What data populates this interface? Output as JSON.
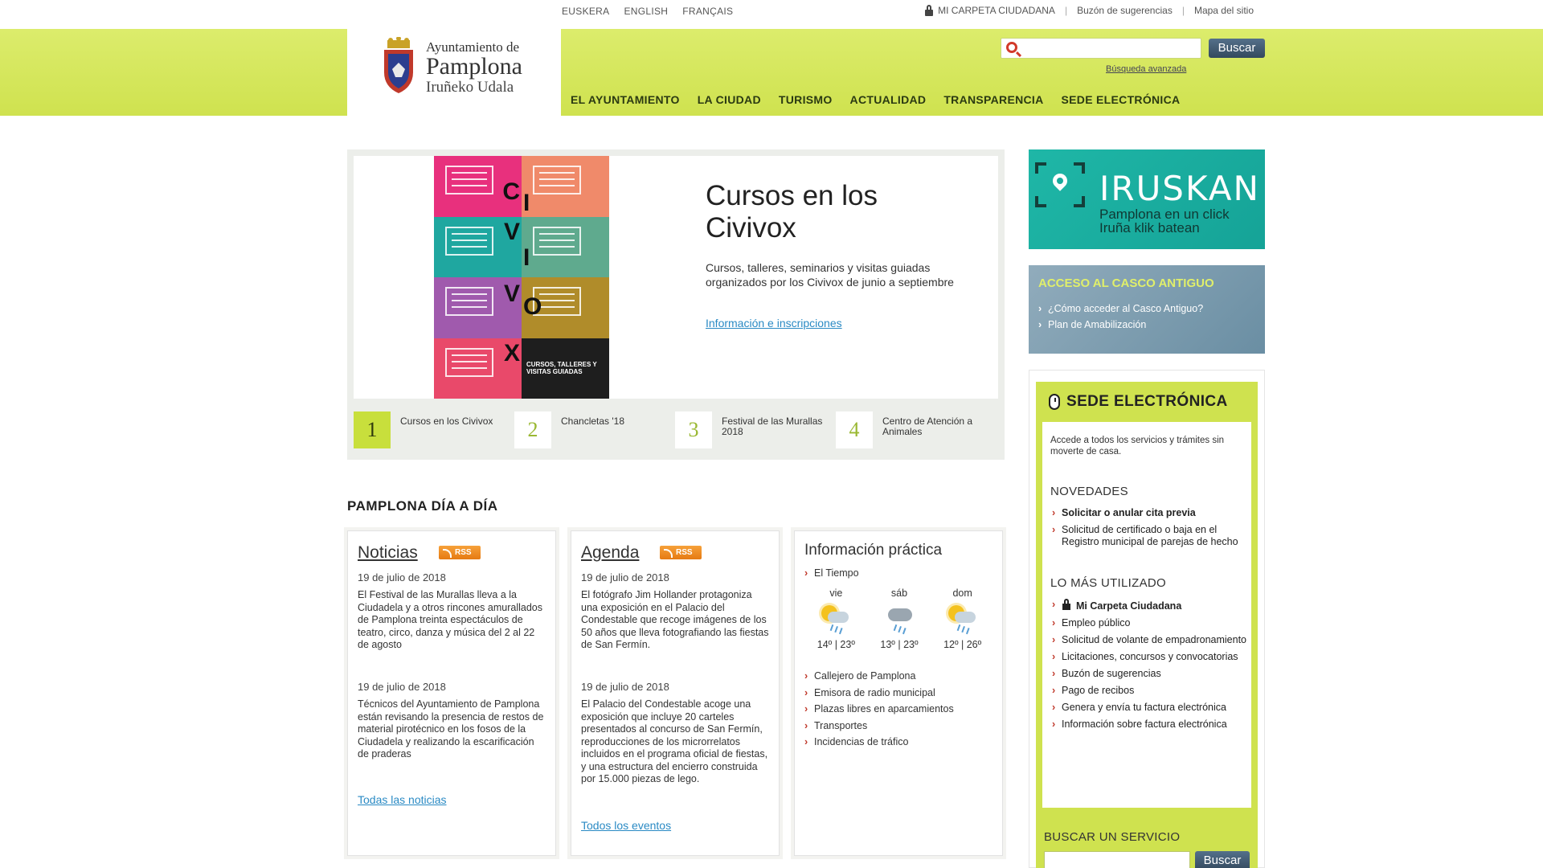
{
  "topbar": {
    "languages": [
      "EUSKERA",
      "ENGLISH",
      "FRANÇAIS"
    ],
    "carpeta": "MI CARPETA CIUDADANA",
    "buzon": "Buzón de sugerencias",
    "mapa": "Mapa del sitio"
  },
  "logo": {
    "line1": "Ayuntamiento de",
    "line2": "Pamplona",
    "line3": "Iruñeko Udala"
  },
  "search": {
    "button": "Buscar",
    "advanced": "Búsqueda avanzada"
  },
  "nav": [
    "EL AYUNTAMIENTO",
    "LA CIUDAD",
    "TURISMO",
    "ACTUALIDAD",
    "TRANSPARENCIA",
    "SEDE ELECTRÓNICA"
  ],
  "hero": {
    "title": "Cursos en los Civivox",
    "description": "Cursos, talleres, seminarios y visitas guiadas organizados por los Civivox de junio a septiembre",
    "link": "Información e inscripciones",
    "poster_letters": [
      "C",
      "I",
      "V",
      "I",
      "V",
      "O",
      "X"
    ],
    "poster_caption": "CURSOS, TALLERES Y VISITAS GUIADAS"
  },
  "slider_tabs": [
    {
      "num": "1",
      "label": "Cursos en los Civivox"
    },
    {
      "num": "2",
      "label": "Chancletas '18"
    },
    {
      "num": "3",
      "label": "Festival de las Murallas 2018"
    },
    {
      "num": "4",
      "label": "Centro de Atención a Animales"
    }
  ],
  "section_title": "PAMPLONA DÍA A DÍA",
  "noticias": {
    "title": "Noticias",
    "rss": "RSS",
    "items": [
      {
        "date": "19 de julio de 2018",
        "text": "El Festival de las Murallas lleva a la Ciudadela y a otros rincones amurallados de Pamplona treinta espectáculos de teatro, circo, danza y música del 2 al 22 de agosto"
      },
      {
        "date": "19 de julio de 2018",
        "text": "Técnicos del Ayuntamiento de Pamplona están revisando la presencia de restos de material pirotécnico en los fosos de la Ciudadela y realizando la escarificación de praderas"
      }
    ],
    "link": "Todas las noticias"
  },
  "agenda": {
    "title": "Agenda",
    "rss": "RSS",
    "items": [
      {
        "date": "19 de julio de 2018",
        "text": "El fotógrafo Jim Hollander protagoniza una exposición en el Palacio del Condestable que recoge imágenes de los 50 años que lleva fotografiando las fiestas de San Fermín."
      },
      {
        "date": "19 de julio de 2018",
        "text": "El Palacio del Condestable acoge una exposición que incluye 20 carteles presentados al concurso de San Fermín, reproducciones de los microrrelatos incluidos en el programa oficial de fiestas, y una estructura del encierro construida por 15.000 piezas de lego."
      }
    ],
    "link": "Todos los eventos"
  },
  "practica": {
    "title": "Información práctica",
    "tiempo": "El Tiempo",
    "weather": [
      {
        "day": "vie",
        "temp": "14º | 23º",
        "icon": "sun-rain-icon"
      },
      {
        "day": "sáb",
        "temp": "13º | 23º",
        "icon": "cloud-rain-icon"
      },
      {
        "day": "dom",
        "temp": "12º | 26º",
        "icon": "sun-rain-icon"
      }
    ],
    "links": [
      "Callejero de Pamplona",
      "Emisora de radio municipal",
      "Plazas libres en aparcamientos",
      "Transportes",
      "Incidencias de tráfico"
    ]
  },
  "iruskan": {
    "title": "IRUSKAN",
    "line1": "Pamplona en un click",
    "line2": "Iruña klik batean"
  },
  "casco": {
    "title": "ACCESO AL CASCO ANTIGUO",
    "links": [
      "¿Cómo acceder al Casco Antiguo?",
      "Plan de Amabilización"
    ]
  },
  "sede": {
    "title": "SEDE ELECTRÓNICA",
    "intro": "Accede a todos los servicios y trámites sin moverte de casa.",
    "novedades_title": "NOVEDADES",
    "novedades": [
      "Solicitar o anular cita previa",
      "Solicitud de certificado o baja en el Registro municipal de parejas de hecho"
    ],
    "mas_title": "LO MÁS UTILIZADO",
    "mas": [
      "Mi Carpeta Ciudadana",
      "Empleo público",
      "Solicitud de volante de empadronamiento",
      "Licitaciones, concursos y convocatorias",
      "Buzón de sugerencias",
      "Pago de recibos",
      "Genera y envía tu factura electrónica",
      "Información sobre factura electrónica"
    ],
    "buscar_title": "BUSCAR UN SERVICIO",
    "buscar_button": "Buscar"
  },
  "colors": {
    "header_green": "#cfe24f",
    "teal": "#1aaa9c",
    "link_blue": "#2a8ac4",
    "button_dark": "#34495e"
  }
}
